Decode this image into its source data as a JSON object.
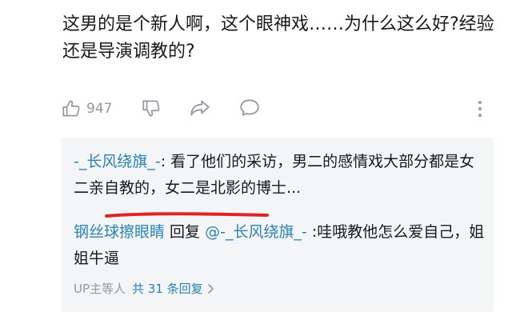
{
  "comment": {
    "text": "这男的是个新人啊，这个眼神戏……为什么这么好?经验还是导演调教的?"
  },
  "actions": {
    "like_count": "947",
    "icons": [
      "thumbs-up-icon",
      "thumbs-down-icon",
      "share-icon",
      "reply-icon",
      "more-icon"
    ]
  },
  "replies": [
    {
      "username": "-_长风绕旗_-",
      "separator": ": ",
      "text": "看了他们的采访，男二的感情戏大部分都是女二亲自教的，女二是北影的博士..."
    },
    {
      "username": "钢丝球擦眼睛",
      "reply_word": " 回复 ",
      "at_name": "@-_长风绕旗_-",
      "separator": " :",
      "text": "哇哦教他怎么爱自己，姐姐牛逼"
    }
  ],
  "reply_footer": {
    "prefix": "UP主等人",
    "more_text": "共 31 条回复"
  },
  "colors": {
    "link": "#2a82b3",
    "muted": "#9499a0",
    "annotation": "#e02424",
    "reply_bg": "#f4f5f7"
  }
}
